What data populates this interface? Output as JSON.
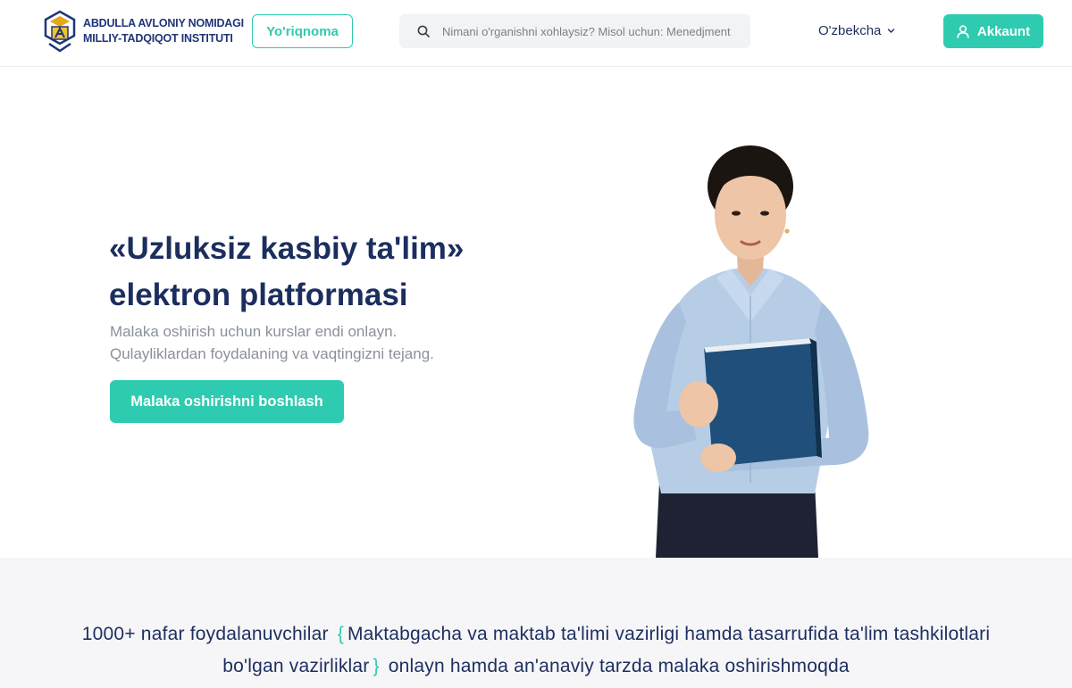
{
  "header": {
    "logo": {
      "line1": "ABDULLA AVLONIY NOMIDAGI",
      "line2": "MILLIY-TADQIQOT INSTITUTI",
      "icon": "institute-logo-icon"
    },
    "guide_label": "Yo'riqnoma",
    "search": {
      "placeholder": "Nimani o'rganishni xohlaysiz? Misol uchun: Menedjment",
      "icon": "search-icon"
    },
    "language": {
      "selected": "O'zbekcha",
      "icon": "chevron-down-icon"
    },
    "account_label": "Akkaunt",
    "account_icon": "user-icon"
  },
  "hero": {
    "title_line1": "«Uzluksiz kasbiy ta'lim»",
    "title_line2": "elektron platformasi",
    "subtitle_line1": "Malaka oshirish uchun kurslar endi onlayn.",
    "subtitle_line2": "Qulayliklardan foydalaning va vaqtingizni tejang.",
    "cta_label": "Malaka oshirishni boshlash"
  },
  "stats": {
    "lead": "1000+ nafar foydalanuvchilar",
    "brace_open": "{",
    "highlight": "Maktabgacha va maktab ta'limi vazirligi hamda tasarrufida ta'lim tashkilotlari bo'lgan vazirliklar",
    "brace_close": "}",
    "tail": "onlayn hamda an'anaviy tarzda malaka oshirishmoqda"
  },
  "colors": {
    "accent": "#2fcbb0",
    "navy": "#1c2e5e",
    "muted": "#8a909a",
    "band_bg": "#f6f6f8"
  }
}
